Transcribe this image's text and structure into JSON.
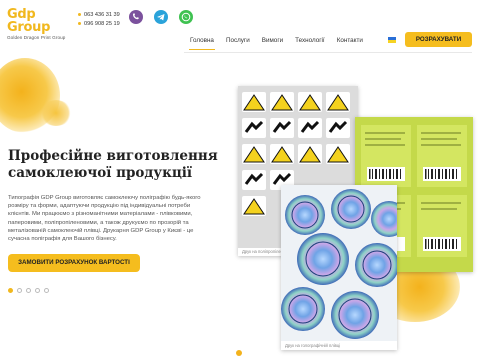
{
  "brand": {
    "logo_main": "Gdp Group",
    "logo_sub": "Golden Dragon Print Group",
    "accent_color": "#f5bd1e"
  },
  "contacts": {
    "phone1": "063 436 31 39",
    "phone2": "096 908 25 19",
    "icons": [
      "viber-icon",
      "telegram-icon",
      "whatsapp-icon"
    ]
  },
  "nav": {
    "items": [
      {
        "label": "Головна",
        "active": true
      },
      {
        "label": "Послуги",
        "active": false
      },
      {
        "label": "Вимоги",
        "active": false
      },
      {
        "label": "Технології",
        "active": false
      },
      {
        "label": "Контакти",
        "active": false
      }
    ],
    "language_flag": "ukraine-flag-icon",
    "cta_label": "РОЗРАХУВАТИ"
  },
  "hero": {
    "title_line1": "Професійне виготовлення",
    "title_line2": "самоклеючої продукції",
    "text": "Типографія GDP Group виготовляє самоклеючу поліграфію будь-якого розміру та форми, адаптуючи продукцію під індивідуальні потреби клієнтів. Ми працюємо з різноманітними матеріалами - плівковими, паперовими, поліпропіленовими, а також друкуємо по прозорій та металізованій самоклеючій плівці. Друкарня GDP Group у Києві - це сучасна поліграфія для Вашого бізнесу.",
    "cta_label": "ЗАМОВИТИ РОЗРАХУНОК ВАРТОСТІ",
    "slider_dots": 5,
    "active_dot": 0
  },
  "photos": {
    "caption1": "Друк на поліпропілені",
    "caption2": "Друк на голографічній плівці"
  }
}
